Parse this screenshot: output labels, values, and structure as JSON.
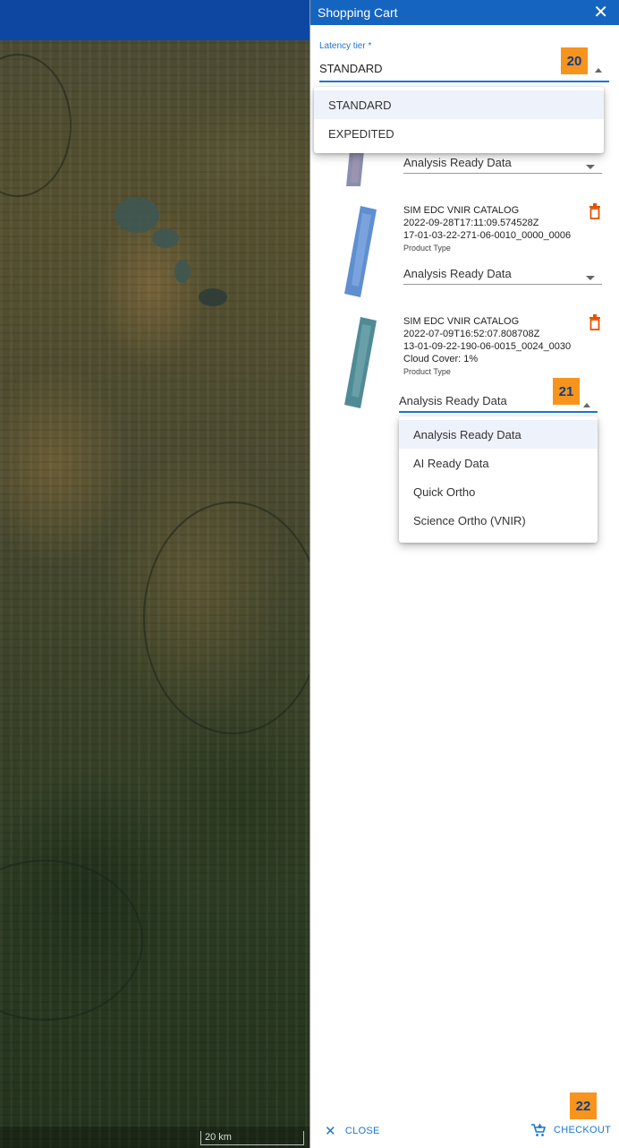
{
  "cart": {
    "title": "Shopping Cart",
    "latency": {
      "label": "Latency tier *",
      "value": "STANDARD",
      "options": [
        "STANDARD",
        "EXPEDITED"
      ]
    },
    "items": [
      {
        "product_type_value": "Analysis Ready Data"
      },
      {
        "catalog": "SIM EDC VNIR CATALOG",
        "timestamp": "2022-09-28T17:11:09.574528Z",
        "id": "17-01-03-22-271-06-0010_0000_0006",
        "product_type_label": "Product Type",
        "product_type_value": "Analysis Ready Data"
      },
      {
        "catalog": "SIM EDC VNIR CATALOG",
        "timestamp": "2022-07-09T16:52:07.808708Z",
        "id": "13-01-09-22-190-06-0015_0024_0030",
        "cloud_cover": "Cloud Cover: 1%",
        "product_type_label": "Product Type",
        "product_type_value": "Analysis Ready Data",
        "product_type_options": [
          "Analysis Ready Data",
          "AI Ready Data",
          "Quick Ortho",
          "Science Ortho (VNIR)"
        ]
      }
    ],
    "footer": {
      "close_label": "CLOSE",
      "checkout_label": "CHECKOUT"
    },
    "badges": {
      "latency": "20",
      "product_type": "21",
      "checkout": "22"
    }
  },
  "map": {
    "scale_label": "20 km"
  },
  "colors": {
    "header": "#1565c0",
    "accent": "#1976d2",
    "badge": "#f7941d",
    "trash": "#e65100"
  }
}
